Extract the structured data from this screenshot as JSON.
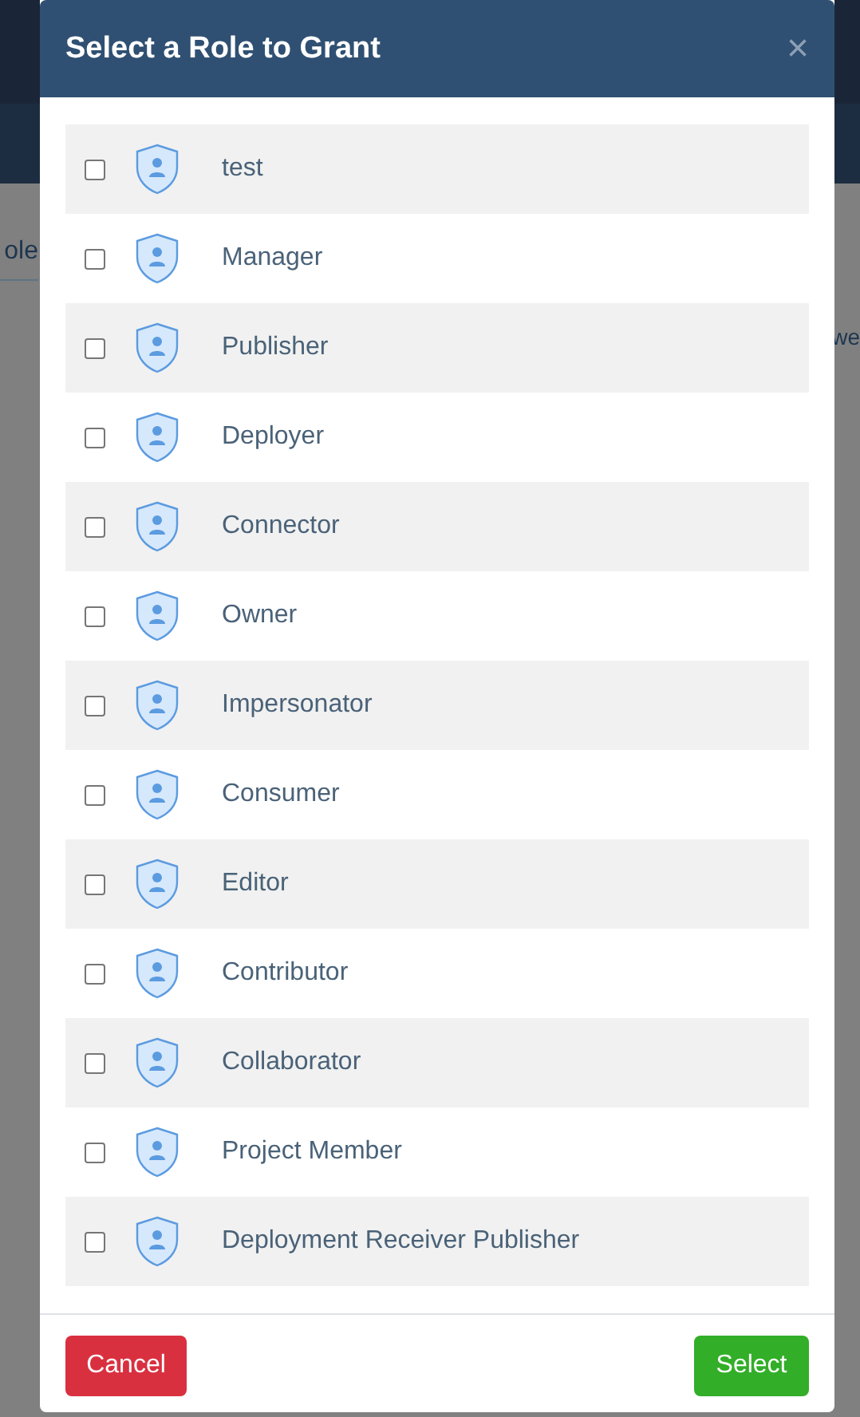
{
  "background": {
    "left_fragment": "ole",
    "right_fragment": "we"
  },
  "dialog": {
    "title": "Select a Role to Grant",
    "close": "×",
    "roles": [
      {
        "name": "test",
        "checked": false
      },
      {
        "name": "Manager",
        "checked": false
      },
      {
        "name": "Publisher",
        "checked": false
      },
      {
        "name": "Deployer",
        "checked": false
      },
      {
        "name": "Connector",
        "checked": false
      },
      {
        "name": "Owner",
        "checked": false
      },
      {
        "name": "Impersonator",
        "checked": false
      },
      {
        "name": "Consumer",
        "checked": false
      },
      {
        "name": "Editor",
        "checked": false
      },
      {
        "name": "Contributor",
        "checked": false
      },
      {
        "name": "Collaborator",
        "checked": false
      },
      {
        "name": "Project Member",
        "checked": false
      },
      {
        "name": "Deployment Receiver Publisher",
        "checked": false
      }
    ],
    "cancel": "Cancel",
    "select": "Select"
  }
}
